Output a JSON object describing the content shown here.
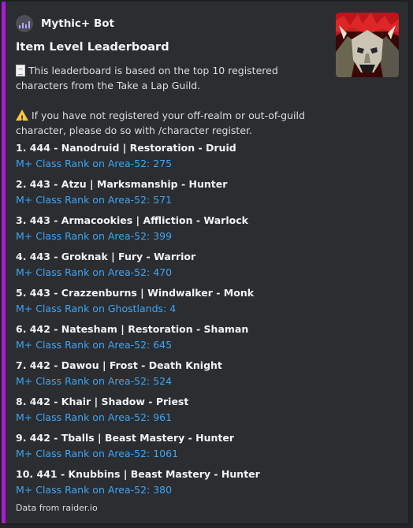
{
  "embed": {
    "accent_color": "#a81cd1",
    "author": {
      "name": "Mythic+ Bot",
      "icon": "bar-chart-icon"
    },
    "thumbnail": "creature-portrait",
    "title": "Item Level Leaderboard",
    "description_1": "This leaderboard is based on the top 10 registered characters from the Take a Lap Guild.",
    "description_2": "If you have not registered your off-realm or out-of-guild character, please do so with /character register.",
    "entries": [
      {
        "head": "1. 444 - Nanodruid | Restoration - Druid",
        "link": "M+ Class Rank on Area-52: 275"
      },
      {
        "head": "2. 443 - Atzu | Marksmanship - Hunter",
        "link": "M+ Class Rank on Area-52: 571"
      },
      {
        "head": "3. 443 - Armacookies | Affliction - Warlock",
        "link": "M+ Class Rank on Area-52: 399"
      },
      {
        "head": "4. 443 - Groknak | Fury - Warrior",
        "link": "M+ Class Rank on Area-52: 470"
      },
      {
        "head": "5. 443 - Crazzenburns | Windwalker - Monk",
        "link": "M+ Class Rank on Ghostlands: 4"
      },
      {
        "head": "6. 442 - Natesham | Restoration - Shaman",
        "link": "M+ Class Rank on Area-52: 645"
      },
      {
        "head": "7. 442 - Dawou | Frost - Death Knight",
        "link": "M+ Class Rank on Area-52: 524"
      },
      {
        "head": "8. 442 - Khair | Shadow - Priest",
        "link": "M+ Class Rank on Area-52: 961"
      },
      {
        "head": "9. 442 - Tballs | Beast Mastery - Hunter",
        "link": "M+ Class Rank on Area-52: 1061"
      },
      {
        "head": "10. 441 - Knubbins | Beast Mastery - Hunter",
        "link": "M+ Class Rank on Area-52: 380"
      }
    ],
    "footer": "Data from raider.io"
  }
}
